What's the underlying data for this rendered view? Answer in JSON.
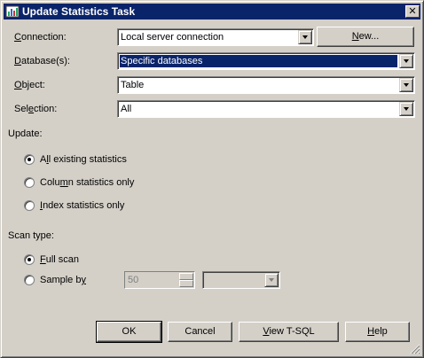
{
  "window": {
    "title": "Update Statistics Task",
    "close_glyph": "✕"
  },
  "fields": {
    "connection": {
      "label_prefix": "",
      "label_accel": "C",
      "label_rest": "onnection:",
      "value": "Local server connection"
    },
    "database": {
      "label_prefix": "",
      "label_accel": "D",
      "label_rest": "atabase(s):",
      "value": "Specific databases"
    },
    "object": {
      "label_prefix": "",
      "label_accel": "O",
      "label_rest": "bject:",
      "value": "Table"
    },
    "selection": {
      "label_prefix": "Sel",
      "label_accel": "e",
      "label_rest": "ction:",
      "value": "All"
    }
  },
  "new_button": {
    "prefix": "",
    "accel": "N",
    "rest": "ew..."
  },
  "update_section": {
    "label": "Update:",
    "options": [
      {
        "prefix": "A",
        "accel": "l",
        "rest": "l existing statistics",
        "selected": true
      },
      {
        "prefix": "Colu",
        "accel": "m",
        "rest": "n statistics only",
        "selected": false
      },
      {
        "prefix": "",
        "accel": "I",
        "rest": "ndex statistics only",
        "selected": false
      }
    ]
  },
  "scan_section": {
    "label": "Scan type:",
    "full_scan": {
      "prefix": "",
      "accel": "F",
      "rest": "ull scan",
      "selected": true
    },
    "sample_by": {
      "prefix": "Sample b",
      "accel": "y",
      "rest": "",
      "selected": false
    },
    "sample_value": "50",
    "sample_unit": ""
  },
  "buttons": {
    "ok": "OK",
    "cancel": "Cancel",
    "view_tsql": {
      "prefix": "",
      "accel": "V",
      "rest": "iew T-SQL"
    },
    "help": {
      "prefix": "",
      "accel": "H",
      "rest": "elp"
    }
  }
}
